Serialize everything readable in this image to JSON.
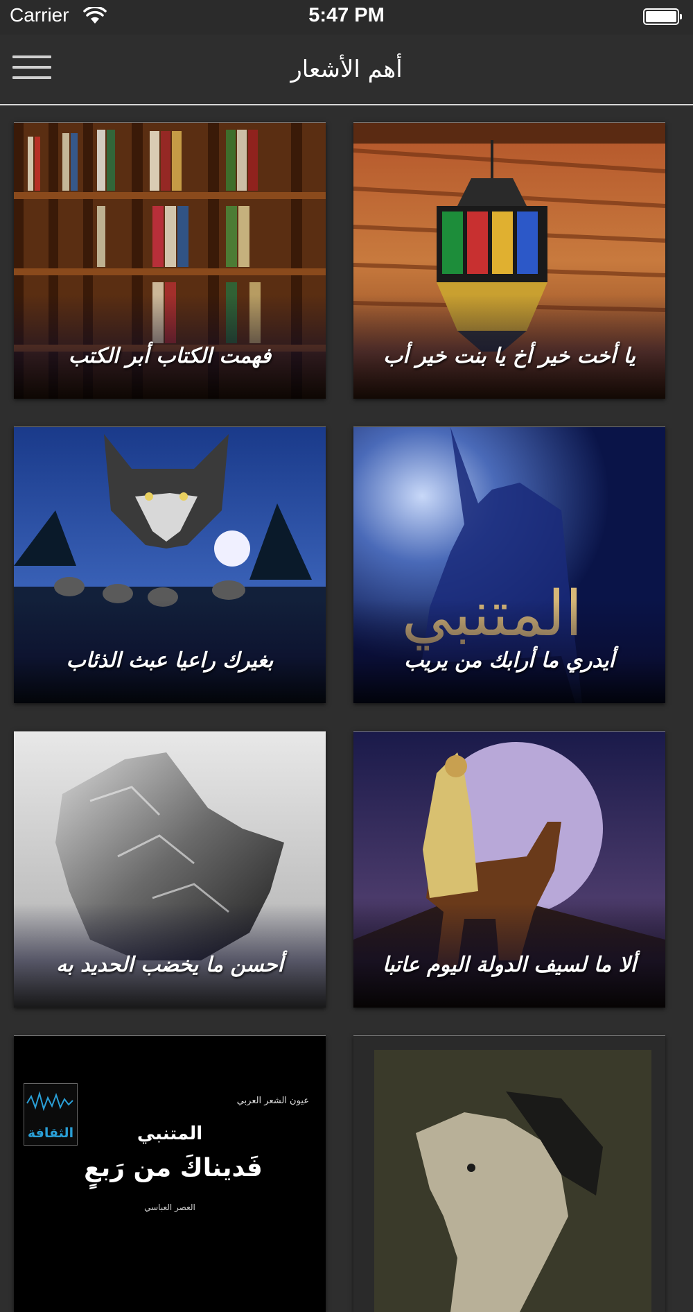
{
  "status_bar": {
    "carrier": "Carrier",
    "time": "5:47 PM"
  },
  "nav": {
    "title": "أهم الأشعار",
    "menu_icon": "hamburger-menu-icon"
  },
  "cards": [
    {
      "caption": "يا أخت خير أخ يا بنت خير أب"
    },
    {
      "caption": "فهمت الكتاب أبر الكتب"
    },
    {
      "caption": "أيدري ما أرابك من يريب"
    },
    {
      "caption": "بغيرك راعيا عبث الذئاب"
    },
    {
      "caption": "ألا ما لسيف الدولة اليوم عاتبا"
    },
    {
      "caption": "أحسن ما يخضب الحديد به"
    },
    {
      "caption": ""
    },
    {
      "caption": "",
      "poster": {
        "series": "عيون الشعر العربي",
        "poet": "المتنبي",
        "title": "فَديناكَ من رَبعٍ",
        "era": "العصر العباسي",
        "logo": "الثقافة"
      }
    }
  ],
  "colors": {
    "background": "#2e2e2e",
    "nav_divider": "#d8d8d8",
    "logo_blue": "#2a9fd6"
  }
}
